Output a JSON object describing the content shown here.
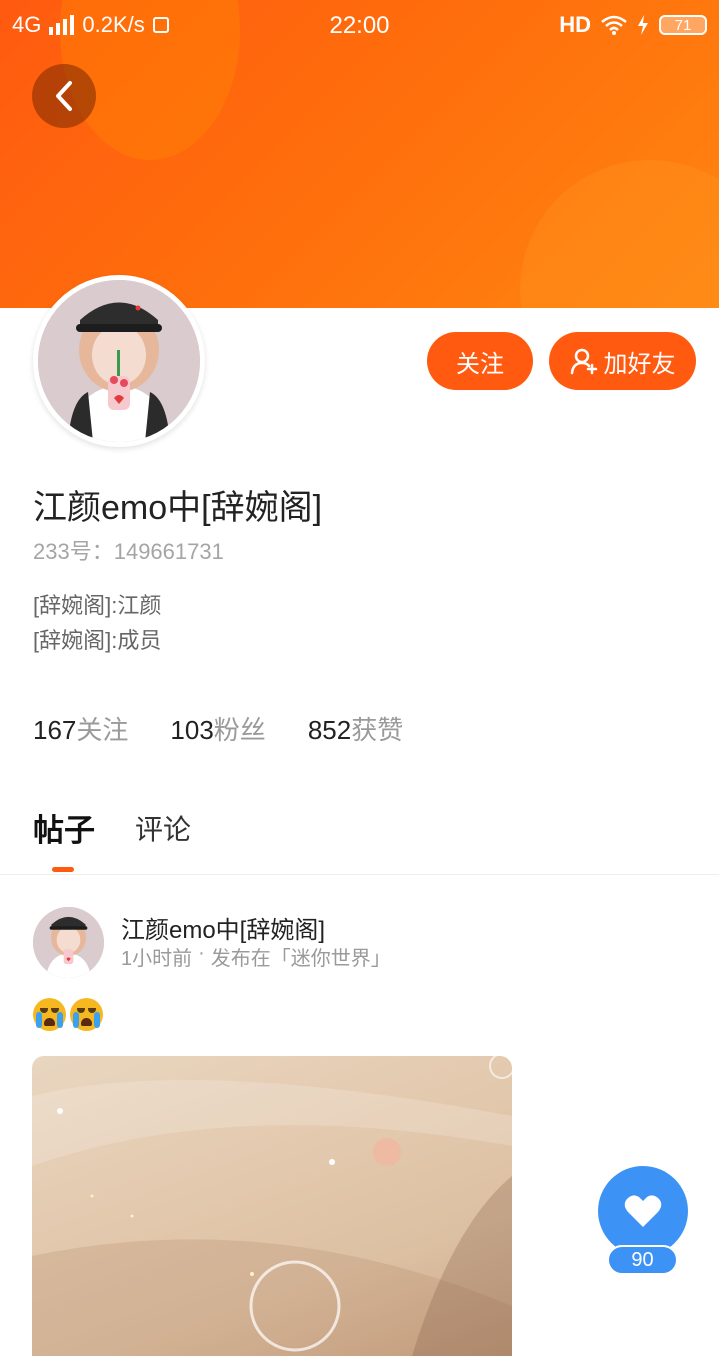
{
  "status_bar": {
    "network": "4G",
    "speed": "0.2K/s",
    "time": "22:00",
    "hd": "HD",
    "battery": "71"
  },
  "profile": {
    "follow_label": "关注",
    "add_friend_label": "加好友",
    "username": "江颜emo中[辞婉阁]",
    "id_label": "233号：",
    "id_value": "149661731",
    "bio": [
      "[辞婉阁]:江颜",
      "[辞婉阁]:成员"
    ],
    "stats": [
      {
        "value": "167",
        "label": "关注"
      },
      {
        "value": "103",
        "label": "粉丝"
      },
      {
        "value": "852",
        "label": "获赞"
      }
    ]
  },
  "tabs": [
    {
      "label": "帖子",
      "active": true
    },
    {
      "label": "评论",
      "active": false
    }
  ],
  "post": {
    "author": "江颜emo中[辞婉阁]",
    "time": "1小时前",
    "separator": "·",
    "published_in": "发布在「迷你世界」",
    "emoji_count": 2
  },
  "like": {
    "count": "90"
  },
  "colors": {
    "accent": "#ff5a10",
    "like_blue": "#3d93f5"
  },
  "icons": [
    "back-chevron-icon",
    "add-user-icon",
    "heart-icon",
    "wifi-icon",
    "charging-icon",
    "signal-icon",
    "crying-emoji-icon"
  ]
}
